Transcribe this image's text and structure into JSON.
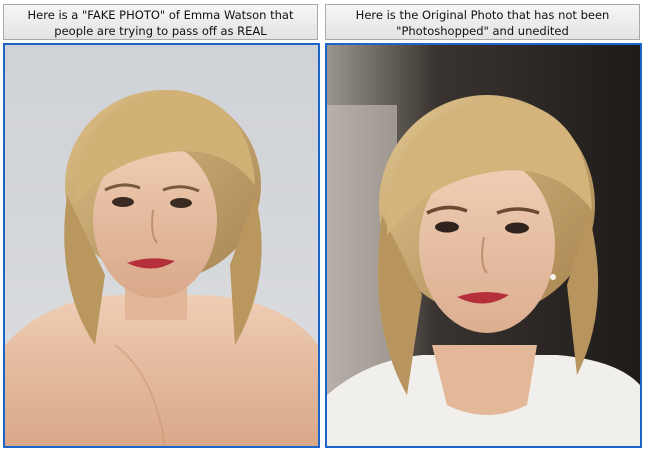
{
  "panels": [
    {
      "caption": "Here is a \"FAKE PHOTO\" of Emma Watson that people are trying to pass off as REAL",
      "caption_line1": "Here is a \"FAKE PHOTO\" of Emma Watson that",
      "caption_line2": "people are trying to pass off as REAL",
      "image_subject": "retouched portrait photo, plain light grey background, bare shoulders",
      "background_color": "#d6d8da"
    },
    {
      "caption": "Here is the Original Photo that has not been \"Photoshopped\" and unedited",
      "caption_line1": "Here is the Original Photo that has not been",
      "caption_line2": "\"Photoshopped\" and unedited",
      "image_subject": "original portrait photo, blurred outdoor background, white sleeveless top",
      "background_color": "#2a2623"
    }
  ],
  "colors": {
    "frame_border": "#1c64c8",
    "caption_border": "#a9a9a9",
    "skin": "#e8c2a6",
    "hair": "#c9a36a",
    "lips": "#b5303a"
  }
}
